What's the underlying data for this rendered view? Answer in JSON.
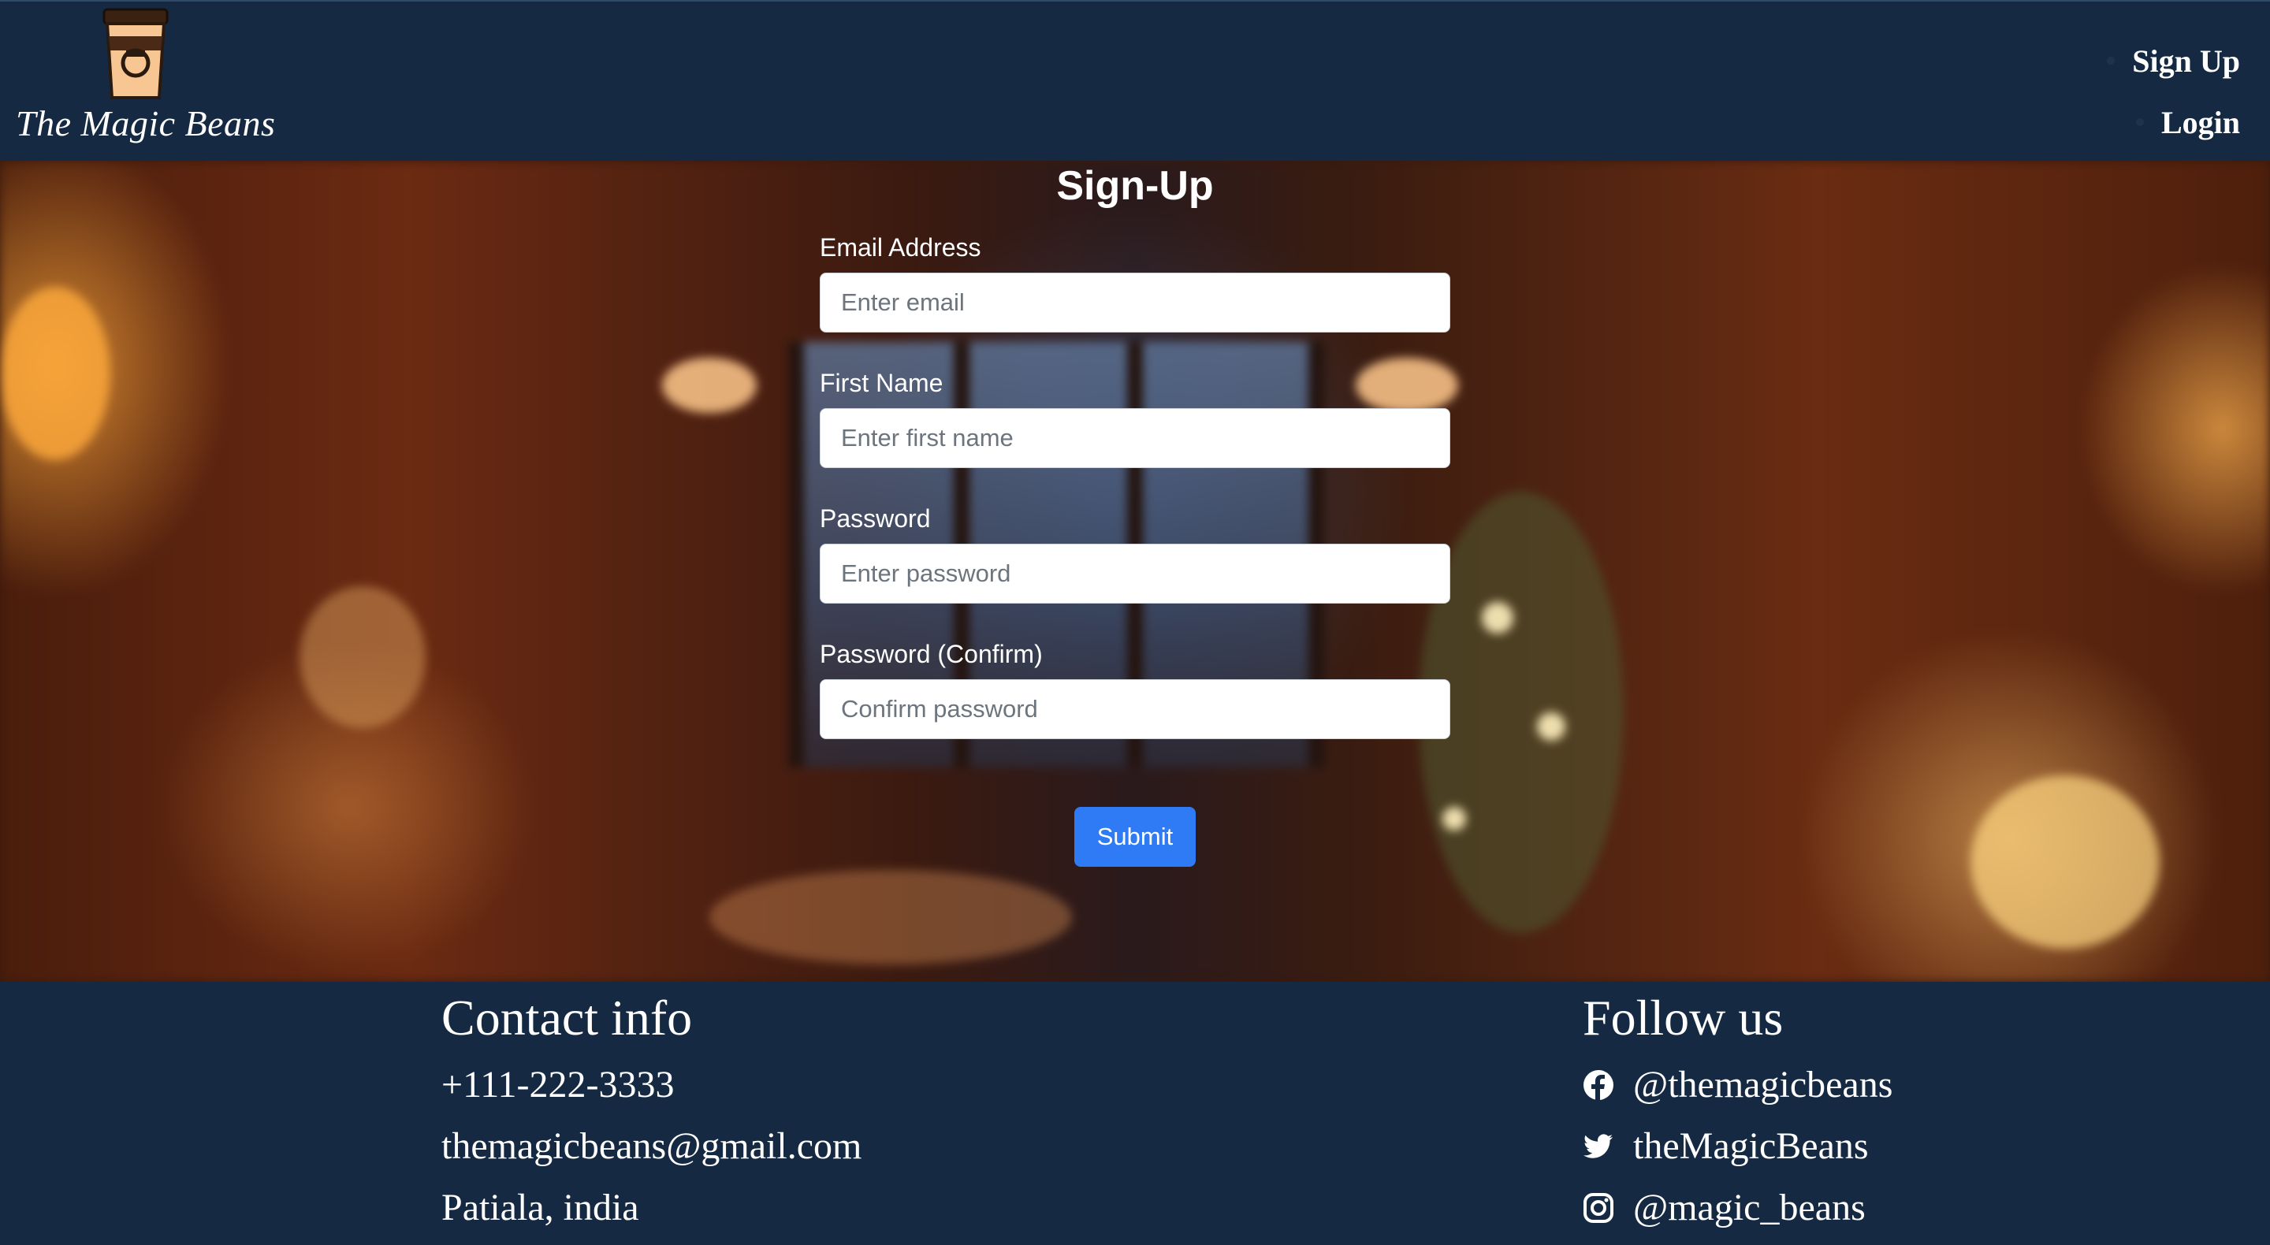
{
  "brand": {
    "name": "The Magic Beans",
    "logo_icon": "coffee-cup-icon"
  },
  "nav": {
    "items": [
      {
        "label": "Sign Up"
      },
      {
        "label": "Login"
      }
    ]
  },
  "form": {
    "title": "Sign-Up",
    "fields": [
      {
        "label": "Email Address",
        "placeholder": "Enter email",
        "value": ""
      },
      {
        "label": "First Name",
        "placeholder": "Enter first name",
        "value": ""
      },
      {
        "label": "Password",
        "placeholder": "Enter password",
        "value": ""
      },
      {
        "label": "Password (Confirm)",
        "placeholder": "Confirm password",
        "value": ""
      }
    ],
    "submit_label": "Submit"
  },
  "footer": {
    "contact": {
      "heading": "Contact info",
      "phone": "+111-222-3333",
      "email": "themagicbeans@gmail.com",
      "location": "Patiala, india"
    },
    "follow": {
      "heading": "Follow us",
      "links": [
        {
          "icon": "facebook-icon",
          "label": "@themagicbeans"
        },
        {
          "icon": "twitter-icon",
          "label": "theMagicBeans"
        },
        {
          "icon": "instagram-icon",
          "label": "@magic_beans"
        }
      ]
    }
  },
  "colors": {
    "header_bg": "#152a42",
    "submit_bg": "#2f7bf5",
    "text": "#ffffff"
  }
}
